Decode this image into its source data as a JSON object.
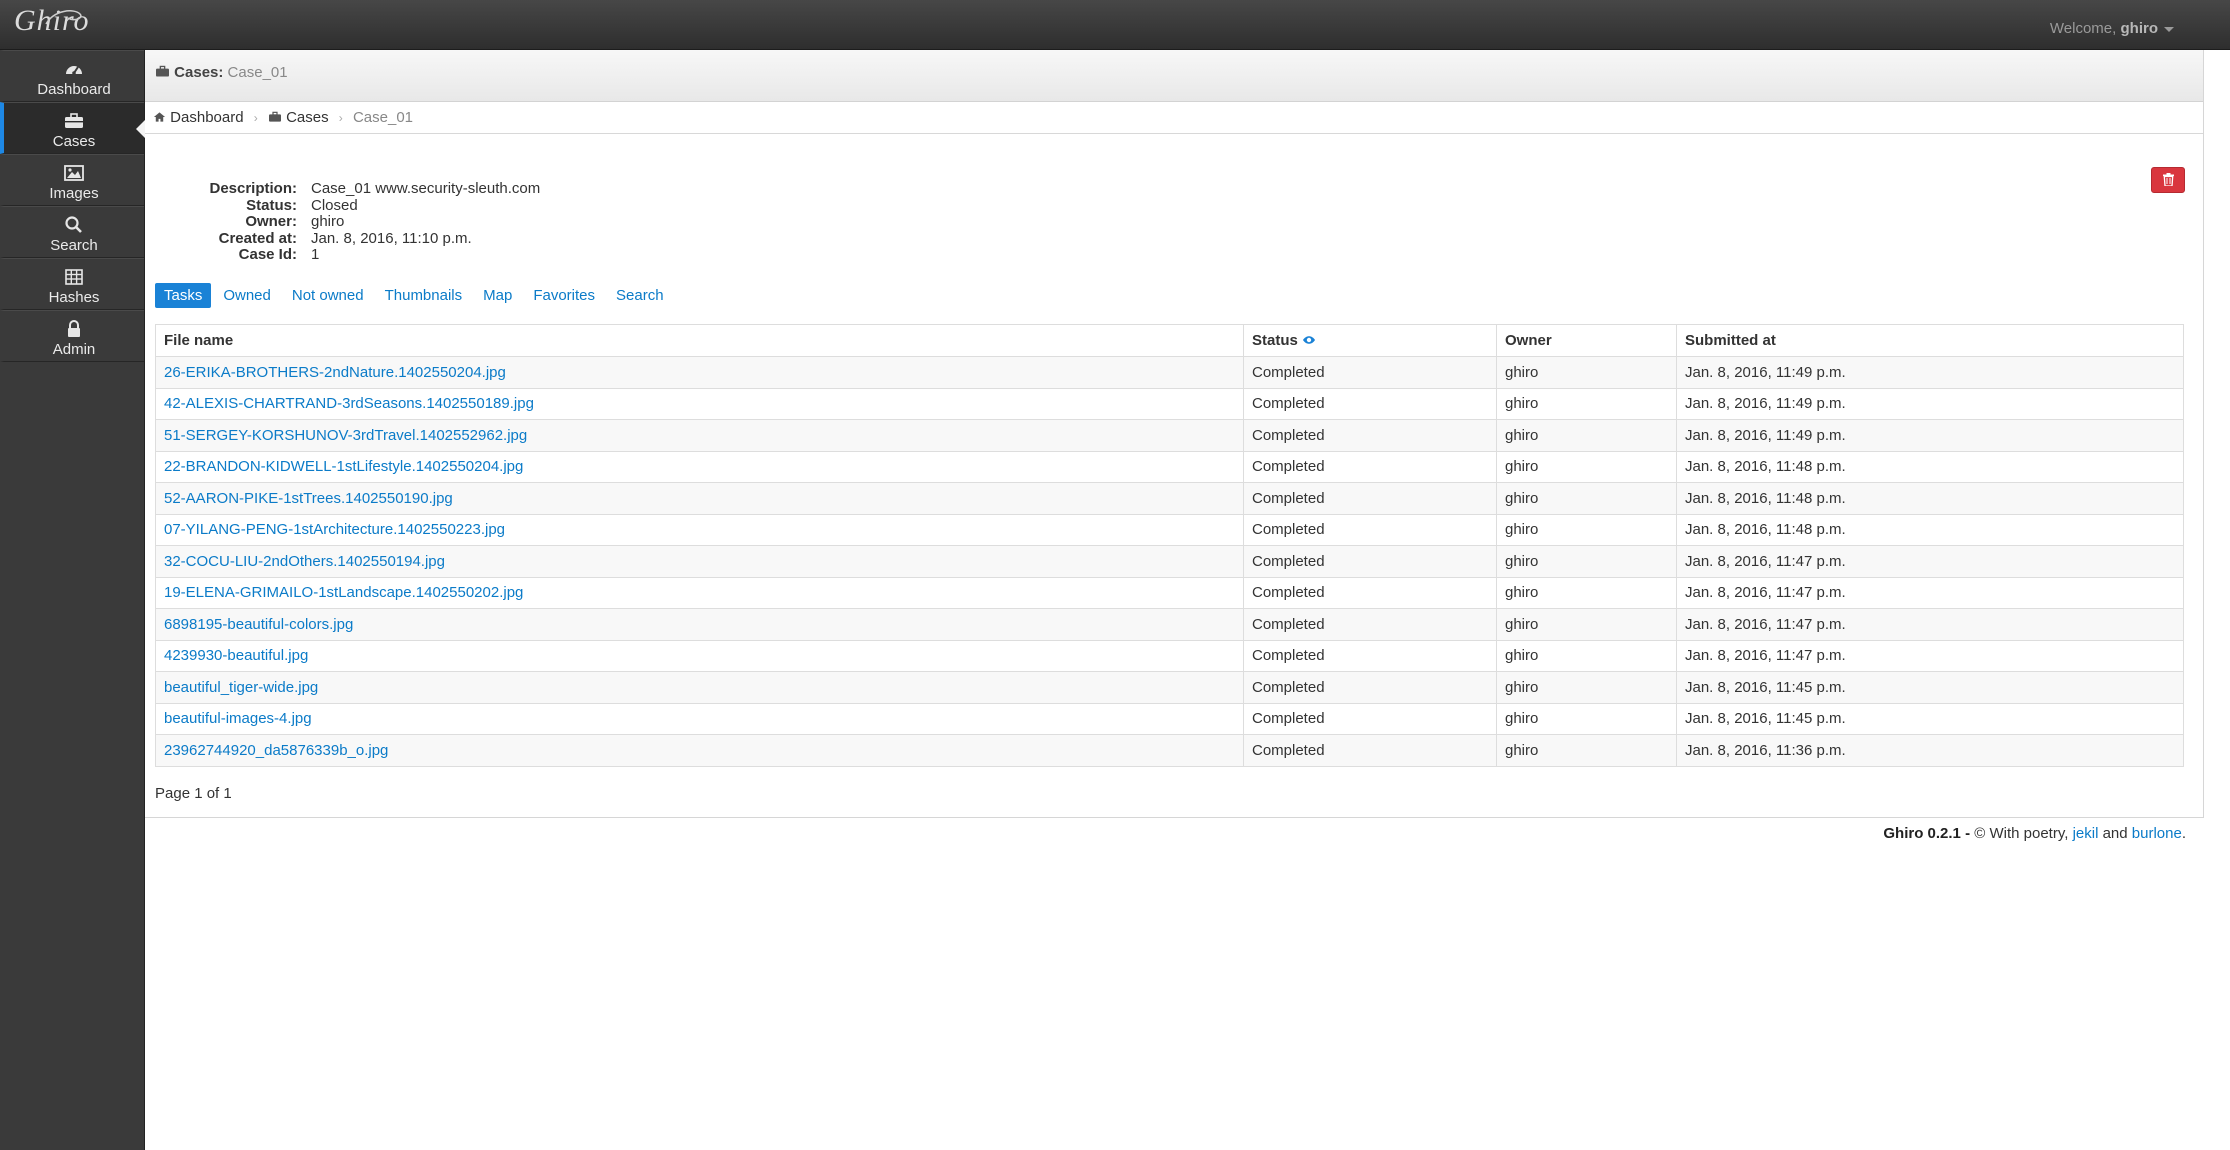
{
  "app": {
    "logo": "Ghiro",
    "welcome_prefix": "Welcome,",
    "user": "ghiro"
  },
  "sidebar": {
    "items": [
      {
        "label": "Dashboard",
        "icon": "dashboard-icon"
      },
      {
        "label": "Cases",
        "icon": "briefcase-icon",
        "active": true
      },
      {
        "label": "Images",
        "icon": "image-icon"
      },
      {
        "label": "Search",
        "icon": "search-icon"
      },
      {
        "label": "Hashes",
        "icon": "grid-icon"
      },
      {
        "label": "Admin",
        "icon": "lock-icon"
      }
    ]
  },
  "header": {
    "section": "Cases:",
    "case_name": "Case_01"
  },
  "breadcrumb": {
    "dashboard": "Dashboard",
    "cases": "Cases",
    "current": "Case_01"
  },
  "case": {
    "description_label": "Description:",
    "description": "Case_01 www.security-sleuth.com",
    "status_label": "Status:",
    "status": "Closed",
    "owner_label": "Owner:",
    "owner": "ghiro",
    "created_label": "Created at:",
    "created": "Jan. 8, 2016, 11:10 p.m.",
    "id_label": "Case Id:",
    "id": "1"
  },
  "tabs": [
    "Tasks",
    "Owned",
    "Not owned",
    "Thumbnails",
    "Map",
    "Favorites",
    "Search"
  ],
  "table": {
    "headers": [
      "File name",
      "Status",
      "Owner",
      "Submitted at"
    ],
    "rows": [
      [
        "26-ERIKA-BROTHERS-2ndNature.1402550204.jpg",
        "Completed",
        "ghiro",
        "Jan. 8, 2016, 11:49 p.m."
      ],
      [
        "42-ALEXIS-CHARTRAND-3rdSeasons.1402550189.jpg",
        "Completed",
        "ghiro",
        "Jan. 8, 2016, 11:49 p.m."
      ],
      [
        "51-SERGEY-KORSHUNOV-3rdTravel.1402552962.jpg",
        "Completed",
        "ghiro",
        "Jan. 8, 2016, 11:49 p.m."
      ],
      [
        "22-BRANDON-KIDWELL-1stLifestyle.1402550204.jpg",
        "Completed",
        "ghiro",
        "Jan. 8, 2016, 11:48 p.m."
      ],
      [
        "52-AARON-PIKE-1stTrees.1402550190.jpg",
        "Completed",
        "ghiro",
        "Jan. 8, 2016, 11:48 p.m."
      ],
      [
        "07-YILANG-PENG-1stArchitecture.1402550223.jpg",
        "Completed",
        "ghiro",
        "Jan. 8, 2016, 11:48 p.m."
      ],
      [
        "32-COCU-LIU-2ndOthers.1402550194.jpg",
        "Completed",
        "ghiro",
        "Jan. 8, 2016, 11:47 p.m."
      ],
      [
        "19-ELENA-GRIMAILO-1stLandscape.1402550202.jpg",
        "Completed",
        "ghiro",
        "Jan. 8, 2016, 11:47 p.m."
      ],
      [
        "6898195-beautiful-colors.jpg",
        "Completed",
        "ghiro",
        "Jan. 8, 2016, 11:47 p.m."
      ],
      [
        "4239930-beautiful.jpg",
        "Completed",
        "ghiro",
        "Jan. 8, 2016, 11:47 p.m."
      ],
      [
        "beautiful_tiger-wide.jpg",
        "Completed",
        "ghiro",
        "Jan. 8, 2016, 11:45 p.m."
      ],
      [
        "beautiful-images-4.jpg",
        "Completed",
        "ghiro",
        "Jan. 8, 2016, 11:45 p.m."
      ],
      [
        "23962744920_da5876339b_o.jpg",
        "Completed",
        "ghiro",
        "Jan. 8, 2016, 11:36 p.m."
      ]
    ]
  },
  "pagination": "Page 1 of 1",
  "footer": {
    "version": "Ghiro 0.2.1 -",
    "text": "© With poetry,",
    "author1": "jekil",
    "and": "and",
    "author2": "burlone",
    "end": "."
  },
  "colors": {
    "accent": "#1a82d6",
    "danger": "#d9363e",
    "link": "#0b7bc8"
  }
}
